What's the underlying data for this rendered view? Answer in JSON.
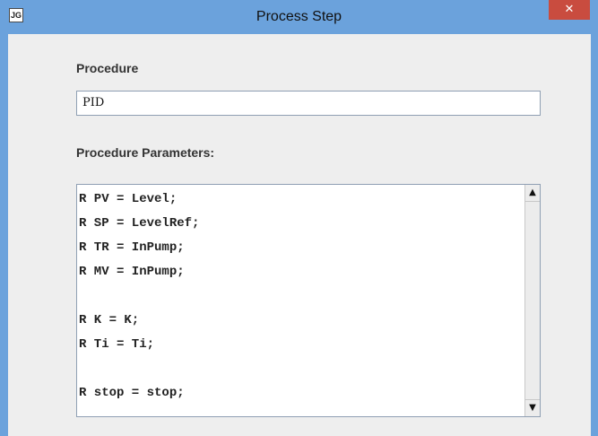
{
  "window": {
    "title": "Process Step",
    "app_icon": "JG",
    "close_glyph": "✕"
  },
  "procedure": {
    "label": "Procedure",
    "value": "PID"
  },
  "parameters": {
    "label": "Procedure Parameters:",
    "lines": [
      "R PV = Level;",
      "R SP = LevelRef;",
      "R TR = InPump;",
      "R MV = InPump;",
      "",
      "R K = K;",
      "R Ti = Ti;",
      "",
      "R stop = stop;"
    ]
  },
  "scrollbar": {
    "up_glyph": "▲",
    "down_glyph": "▼"
  }
}
